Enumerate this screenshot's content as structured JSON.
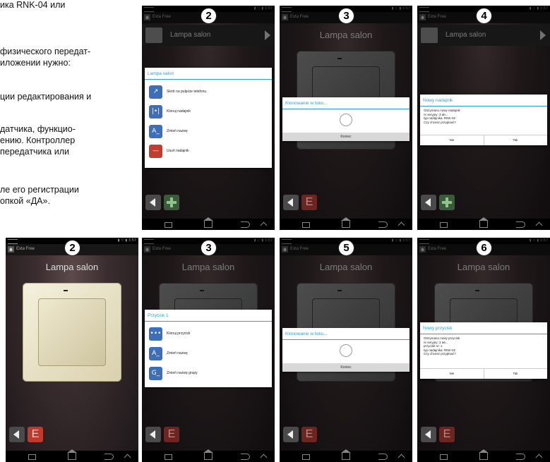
{
  "manual_text": {
    "lines": [
      "ика RNK-04 или",
      "физического передат-",
      "иложении нужно:",
      "ции редактирования и",
      "датчика, функцио-",
      "ению. Контроллер",
      "передатчика или",
      "ле его регистрации",
      "опкой «ДА»."
    ]
  },
  "common": {
    "app_name": "Exta Free",
    "device_title": "Lampa salon",
    "status_right": "▮ ⌔ ▮ 3:57"
  },
  "top_row": [
    {
      "step": "2",
      "menu": {
        "title": "Lampa salon",
        "items": [
          {
            "icon": "↗",
            "label": "Skrót na pulpicie telefonu"
          },
          {
            "icon": "|•|",
            "label": "Klonuj nadajnik"
          },
          {
            "icon": "A_",
            "label": "Zmień nazwę"
          },
          {
            "icon": "—",
            "label": "Usuń nadajnik"
          }
        ]
      }
    },
    {
      "step": "3",
      "progress": {
        "title": "Klonowanie w toku...",
        "footer": "Koniec"
      }
    },
    {
      "step": "4",
      "confirm": {
        "title": "Nowy nadajnik",
        "lines": [
          "Otrzymano nowy nadajnik",
          "nr seryjny: 3 ab...",
          "typ nadajnika: RNK-02",
          "Czy chcesz przypisać?"
        ],
        "no": "Nie",
        "yes": "Tak"
      }
    }
  ],
  "bottom_row": [
    {
      "step": "2"
    },
    {
      "step": "3",
      "menu": {
        "title": "Przycisk 1",
        "items": [
          {
            "icon": "•••",
            "label": "Klonuj przycisk"
          },
          {
            "icon": "A_",
            "label": "Zmień nazwę"
          },
          {
            "icon": "G_",
            "label": "Zmień nazwę grupy"
          }
        ]
      }
    },
    {
      "step": "5",
      "progress": {
        "title": "Klonowanie w toku...",
        "footer": "Koniec"
      }
    },
    {
      "step": "6",
      "confirm": {
        "title": "Nowy przycisk",
        "lines": [
          "Otrzymano nowy przycisk",
          "nr seryjny: 3 a6...",
          "przycisk nr: 1",
          "typ nadajnika: RNK-02",
          "Czy chcesz przypisać?"
        ],
        "no": "Nie",
        "yes": "Tak"
      }
    }
  ]
}
